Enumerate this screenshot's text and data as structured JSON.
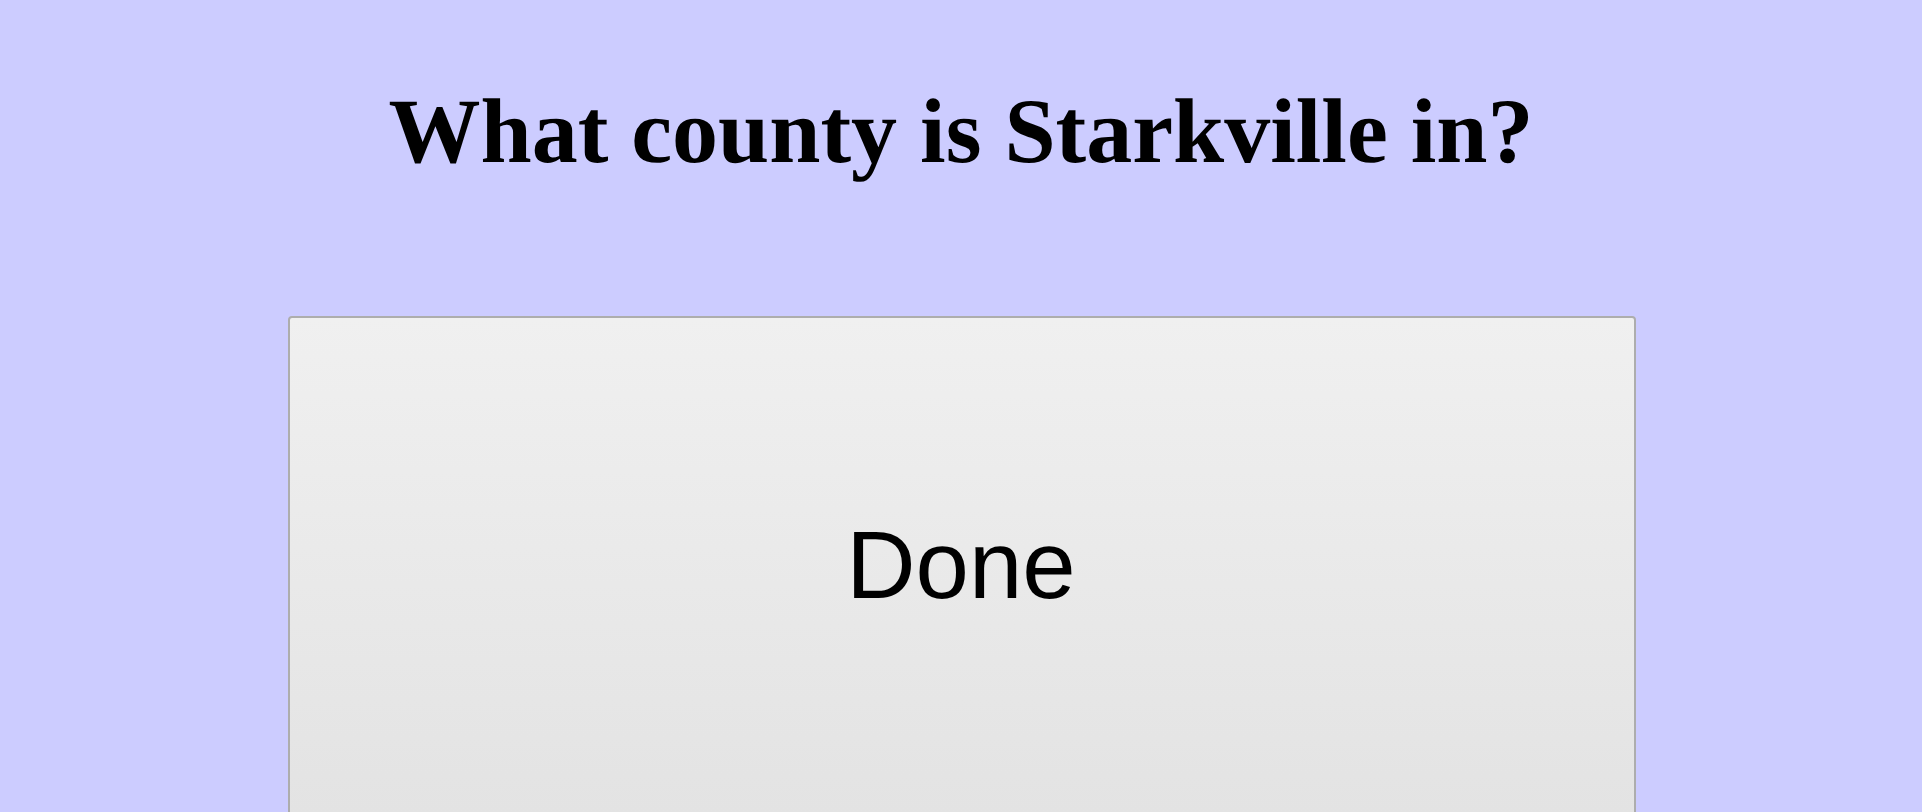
{
  "question": "What county is Starkville in?",
  "button": "Done"
}
